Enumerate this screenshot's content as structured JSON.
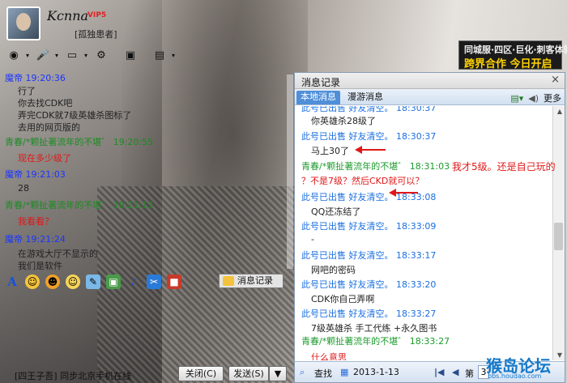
{
  "header": {
    "nickname": "Kcnna",
    "vip_badge": "VIP5",
    "signature": "[孤独患者]"
  },
  "toolbar_icons": [
    "camera-icon",
    "microphone-icon",
    "folder-transfer-icon",
    "remote-assist-icon",
    "screen-share-icon",
    "app-box-icon"
  ],
  "banner": {
    "line1": "同城服·四区·巨化·刺客体验",
    "line2": "跨界合作 今日开启"
  },
  "left_chat": [
    {
      "kind": "blue",
      "text": "魔帝  19:20:36"
    },
    {
      "kind": "dark",
      "text": "行了"
    },
    {
      "kind": "dark",
      "text": "你去找CDK吧"
    },
    {
      "kind": "dark",
      "text": "弄完CDK就7级英雄杀图标了"
    },
    {
      "kind": "dark",
      "text": "去用的网页版的"
    },
    {
      "kind": "green",
      "text": "青春/*颗扯著流年的不堪゛  19:20:55"
    },
    {
      "kind": "red",
      "text": "现在多少级了"
    },
    {
      "kind": "blue",
      "text": "魔帝  19:21:03"
    },
    {
      "kind": "dark",
      "text": "28"
    },
    {
      "kind": "green",
      "text": "青春/*颗扯著流年的不堪゛  19:21:13"
    },
    {
      "kind": "red",
      "text": "我看看？"
    },
    {
      "kind": "blue",
      "text": "魔帝  19:21:24"
    },
    {
      "kind": "dark",
      "text": "在游戏大厅不显示的"
    },
    {
      "kind": "dark",
      "text": "我们是软件"
    }
  ],
  "input_toolbar": {
    "icons": [
      "font-icon",
      "emoji-icon",
      "magic-emoji-icon",
      "shake-icon",
      "handwrite-icon",
      "image-icon",
      "music-icon",
      "screenshot-icon",
      "gift-icon"
    ],
    "message_record_label": "消息记录"
  },
  "footer": {
    "status_text": "[四王子吾] 同步北京手机在线",
    "close_label": "关闭(C)",
    "send_label": "发送(S)",
    "send_dropdown": "▼"
  },
  "history": {
    "title": "消息记录",
    "close": "×",
    "tabs": {
      "local": "本地消息",
      "roaming": "漫游消息"
    },
    "more_label": "更多",
    "messages": [
      {
        "kind": "blue",
        "text": "此号已出售 好友清空。  18:30:37"
      },
      {
        "kind": "msg",
        "text": "你英雄杀28级了"
      },
      {
        "kind": "blue",
        "text": "此号已出售 好友清空。  18:30:37"
      },
      {
        "kind": "msg",
        "text": "马上30了"
      },
      {
        "kind": "green",
        "text": "青春/*颗扯著流年的不堪゛  18:31:03"
      },
      {
        "kind": "red",
        "text": "？不是7级？然后CKD就可以？"
      },
      {
        "kind": "blue",
        "text": "此号已出售 好友清空。  18:33:08"
      },
      {
        "kind": "msg",
        "text": "QQ还冻结了"
      },
      {
        "kind": "blue",
        "text": "此号已出售 好友清空。  18:33:09"
      },
      {
        "kind": "msg",
        "text": "-"
      },
      {
        "kind": "blue",
        "text": "此号已出售 好友清空。  18:33:17"
      },
      {
        "kind": "msg",
        "text": "网吧的密码"
      },
      {
        "kind": "blue",
        "text": "此号已出售 好友清空。  18:33:20"
      },
      {
        "kind": "msg",
        "text": "CDK你自己弄啊"
      },
      {
        "kind": "blue",
        "text": "此号已出售 好友清空。  18:33:27"
      },
      {
        "kind": "msg",
        "text": "7级英雄杀 手工代练 +永久图书"
      },
      {
        "kind": "green",
        "text": "青春/*颗扯著流年的不堪゛  18:33:27"
      },
      {
        "kind": "red",
        "text": "什么意思"
      }
    ],
    "footer": {
      "search_label": "查找",
      "date": "2013-1-13",
      "page_prefix": "第",
      "page_value": "3"
    }
  },
  "annotations": {
    "side_note": "我才5级。还是自己玩的"
  },
  "watermark": {
    "line1": "猴岛论坛",
    "line2": "bbs.houdao.com"
  },
  "colors": {
    "timestamp_blue": "#1a35ff",
    "peer_green": "#1a8c22",
    "self_red": "#e01818",
    "tab_active": "#4f8fd8"
  }
}
